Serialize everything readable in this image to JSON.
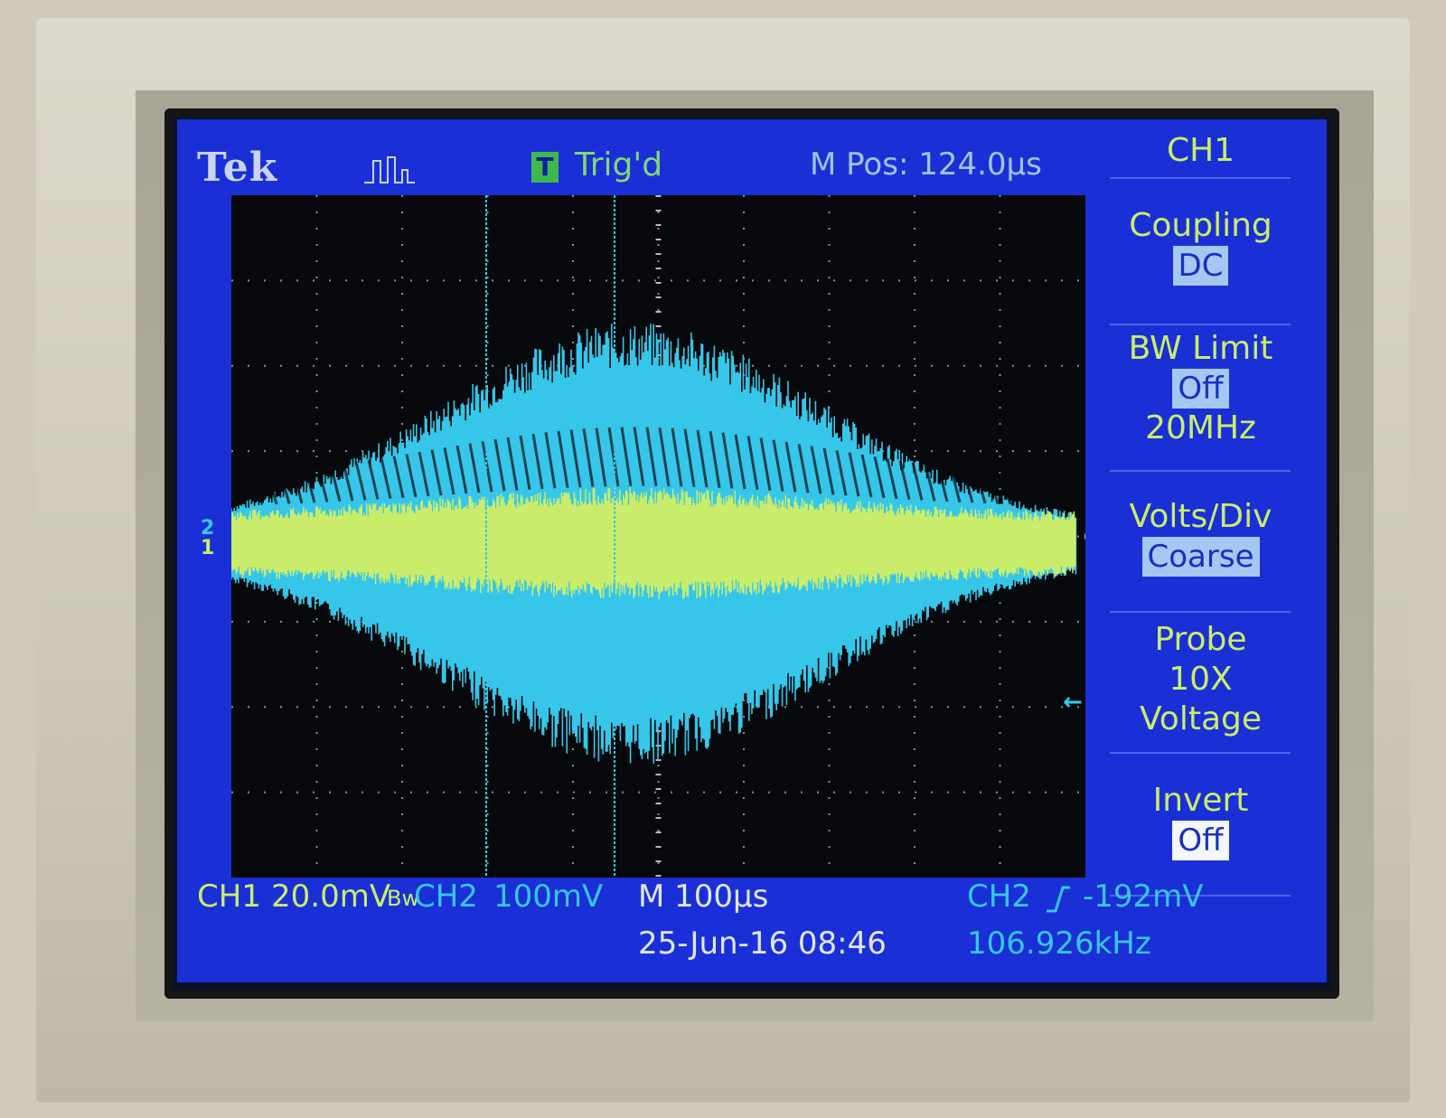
{
  "header": {
    "brand": "Tek",
    "trigger_badge": "T",
    "trigger_status": "Trig'd",
    "main_position": "M Pos: 124.0µs"
  },
  "markers": {
    "ch2": "2",
    "ch1": "1"
  },
  "menu": {
    "title": "CH1",
    "items": [
      {
        "label": "Coupling",
        "value": "DC"
      },
      {
        "label": "BW Limit",
        "value": "Off",
        "sub": "20MHz"
      },
      {
        "label": "Volts/Div",
        "value": "Coarse"
      },
      {
        "label": "Probe",
        "value": "10X",
        "sub": "Voltage"
      },
      {
        "label": "Invert",
        "value": "Off"
      }
    ]
  },
  "status": {
    "ch1_label": "CH1",
    "ch1_scale": "20.0mV",
    "ch1_bw": "Bw",
    "ch2_label": "CH2",
    "ch2_scale": "100mV",
    "timebase": "M 100µs",
    "date_time": "25-Jun-16 08:46",
    "trigger_source": "CH2",
    "trigger_level": "-192mV",
    "frequency": "106.926kHz"
  },
  "colors": {
    "lcd_bg": "#1b2fd6",
    "ch1_trace": "#c9ed6b",
    "ch2_trace": "#36c6ea",
    "graticule_bg": "#08090c"
  },
  "chart_data": {
    "type": "line",
    "series": [
      {
        "name": "CH1",
        "amplitude_div": 0.6
      },
      {
        "name": "CH2",
        "amplitude_div": 2.5
      }
    ],
    "x_divisions": 10,
    "y_divisions": 8
  }
}
